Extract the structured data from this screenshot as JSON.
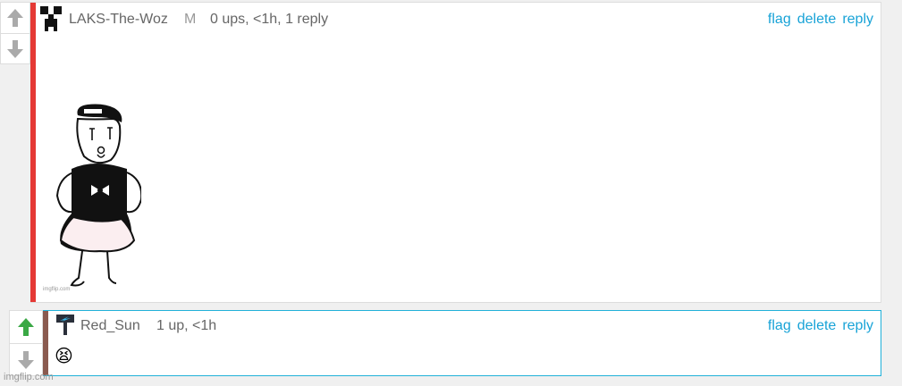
{
  "comments": [
    {
      "username": "LAKS-The-Woz",
      "usertag": "M",
      "meta": "0 ups, <1h, 1 reply",
      "actions": [
        "flag",
        "delete",
        "reply"
      ],
      "image_watermark": "imgflip.com",
      "bar_color": "#e53935"
    },
    {
      "username": "Red_Sun",
      "meta": "1 up, <1h",
      "actions": [
        "flag",
        "delete",
        "reply"
      ],
      "emoji": "😫",
      "bar_color": "#8a5a4f",
      "upvote_color": "#3aa845"
    }
  ],
  "footer_watermark": "imgflip.com"
}
